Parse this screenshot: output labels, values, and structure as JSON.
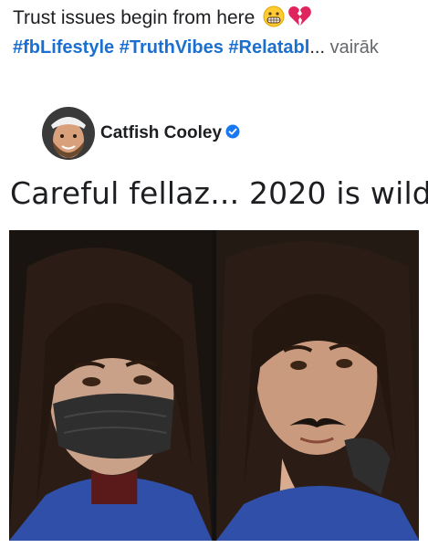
{
  "caption": {
    "text": "Trust issues begin from here",
    "hashtags": [
      "#fbLifestyle",
      "#TruthVibes",
      "#Relatabl"
    ],
    "ellipsis": "...",
    "see_more": "vairāk",
    "emoji_icons": [
      "grimacing-face-icon",
      "broken-heart-icon"
    ]
  },
  "post": {
    "author": "Catfish Cooley",
    "text": "Careful fellaz... 2020 is wild"
  },
  "colors": {
    "hashtag": "#1a6fd0",
    "verified": "#1877f2",
    "text": "#1c1e21"
  }
}
